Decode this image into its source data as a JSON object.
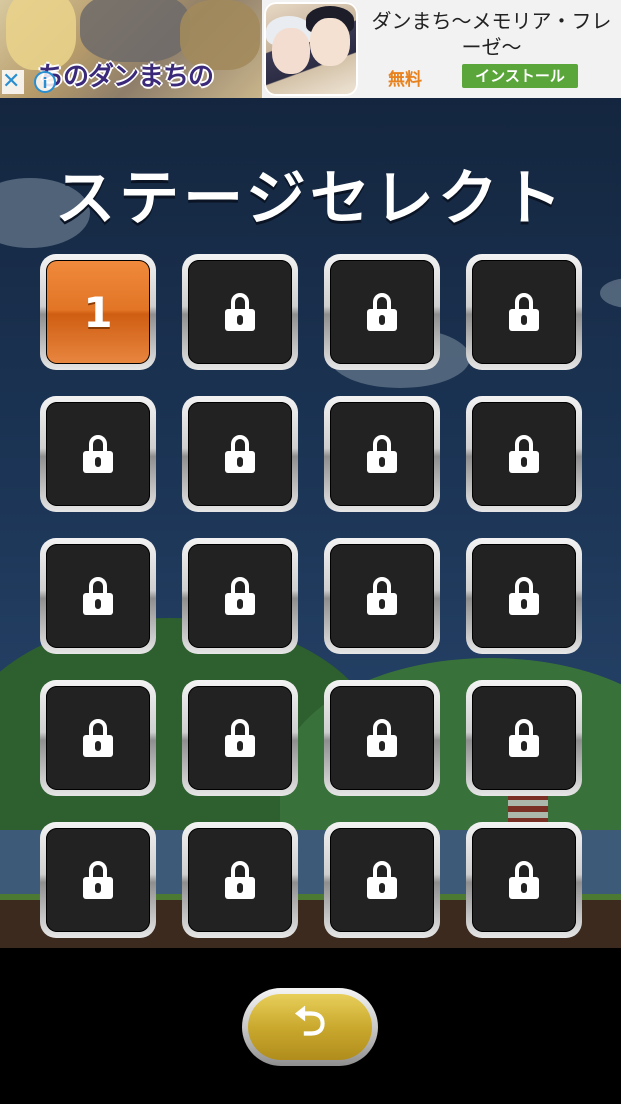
{
  "ad": {
    "art_title": "ちのダンまちの",
    "close_glyph": "✕",
    "info_glyph": "i",
    "app_name": "ダンまち〜メモリア・フレーゼ〜",
    "free_label": "無料",
    "install_label": "インストール"
  },
  "screen": {
    "title": "ステージセレクト"
  },
  "stages": [
    {
      "label": "1",
      "locked": false
    },
    {
      "locked": true
    },
    {
      "locked": true
    },
    {
      "locked": true
    },
    {
      "locked": true
    },
    {
      "locked": true
    },
    {
      "locked": true
    },
    {
      "locked": true
    },
    {
      "locked": true
    },
    {
      "locked": true
    },
    {
      "locked": true
    },
    {
      "locked": true
    },
    {
      "locked": true
    },
    {
      "locked": true
    },
    {
      "locked": true
    },
    {
      "locked": true
    },
    {
      "locked": true
    },
    {
      "locked": true
    },
    {
      "locked": true
    },
    {
      "locked": true
    }
  ],
  "back_button": {
    "icon": "return-arrow-icon",
    "glyph": "⮌"
  },
  "colors": {
    "unlocked_tile": "#e27526",
    "locked_tile": "#222222",
    "back_button": "#caa92e",
    "install_button": "#5aa63a"
  }
}
